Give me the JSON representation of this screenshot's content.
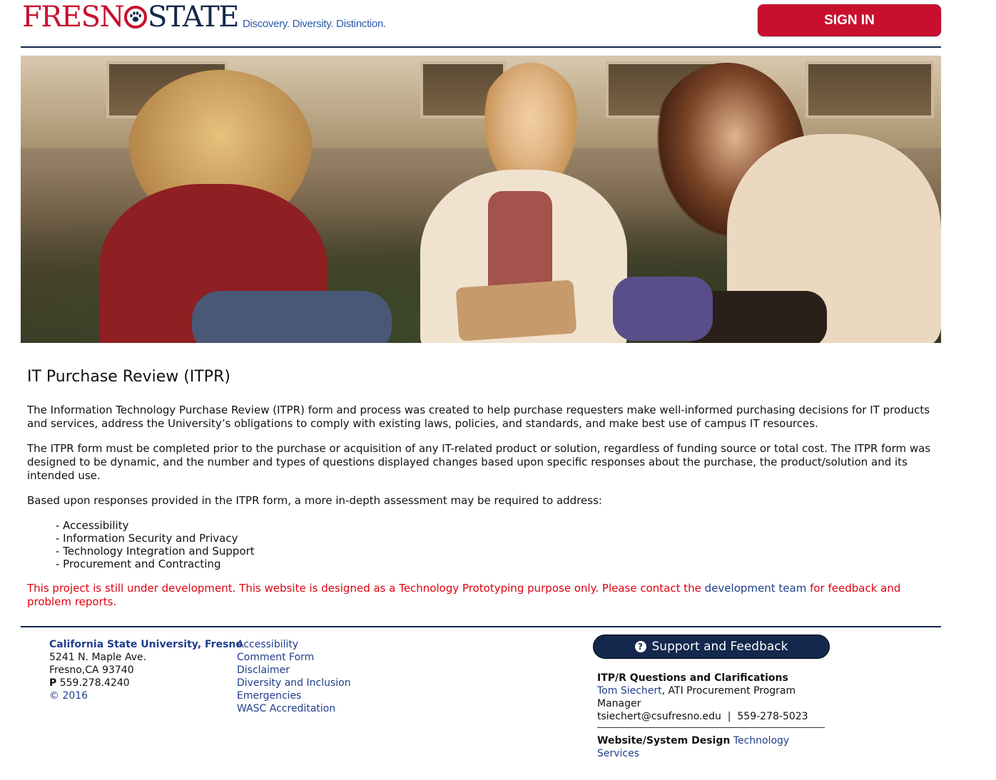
{
  "header": {
    "logo_left": "FRESN",
    "logo_right": "STATE",
    "tagline": "Discovery. Diversity. Distinction.",
    "signin_label": "SIGN IN",
    "brand_red": "#c8102e",
    "brand_navy": "#13284c"
  },
  "main": {
    "title": "IT Purchase Review (ITPR)",
    "paragraphs": [
      "The Information Technology Purchase Review (ITPR) form and process was created to help purchase requesters make well-informed purchasing decisions for IT products and services, address the University’s obligations to comply with existing laws, policies, and standards, and make best use of campus IT resources.",
      "The ITPR form must be completed prior to the purchase or acquisition of any IT-related product or solution, regardless of funding source or total cost. The ITPR form was designed to be dynamic, and the number and types of questions displayed changes based upon specific responses about the purchase, the product/solution and its intended use.",
      "Based upon responses provided in the ITPR form, a more in-depth assessment may be required to address:"
    ],
    "assessments": [
      "- Accessibility",
      "- Information Security and Privacy",
      "- Technology Integration and Support",
      "- Procurement and Contracting"
    ],
    "notice_before": "This project is still under development. This website is designed as a Technology Prototyping purpose only. Please contact the ",
    "notice_link": "development team",
    "notice_after": " for feedback and problem reports."
  },
  "footer": {
    "university": "California State University, Fresno",
    "address1": "5241 N. Maple Ave.",
    "address2": "Fresno,CA 93740",
    "phone_label": "P",
    "phone": " 559.278.4240",
    "copyright": "© 2016",
    "links": [
      "Accessibility",
      "Comment Form",
      "Disclaimer",
      "Diversity and Inclusion",
      "Emergencies",
      "WASC Accreditation"
    ],
    "support_label": "Support and Feedback",
    "support_icon": "question-circle-icon",
    "contact_heading": "ITP/R Questions and Clarifications",
    "contact_name": "Tom Siechert",
    "contact_role": ", ATI Procurement Program Manager",
    "contact_email_phone": "tsiechert@csufresno.edu  |  559-278-5023",
    "design_label": "Website/System Design",
    "design_link": "Technology Services"
  }
}
